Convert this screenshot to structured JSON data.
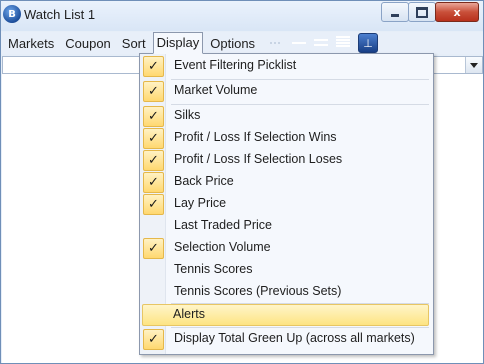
{
  "window": {
    "title": "Watch List 1",
    "app_icon": "B",
    "close_glyph": "x"
  },
  "menubar": {
    "items": [
      "Markets",
      "Coupon",
      "Sort",
      "Display",
      "Options"
    ],
    "open_item": "Display",
    "tool_icons": [
      "dotted-line-icon",
      "single-line-icon",
      "double-line-icon",
      "multi-line-icon",
      "pin-icon"
    ]
  },
  "display_menu": {
    "items": [
      {
        "label": "Event Filtering Picklist",
        "checked": true
      },
      {
        "label": "Market Volume",
        "checked": true
      },
      {
        "label": "Silks",
        "checked": true
      },
      {
        "label": "Profit / Loss If Selection Wins",
        "checked": true
      },
      {
        "label": "Profit / Loss If Selection Loses",
        "checked": true
      },
      {
        "label": "Back Price",
        "checked": true
      },
      {
        "label": "Lay Price",
        "checked": true
      },
      {
        "label": "Last Traded Price",
        "checked": false
      },
      {
        "label": "Selection Volume",
        "checked": true
      },
      {
        "label": "Tennis Scores",
        "checked": false
      },
      {
        "label": "Tennis Scores (Previous Sets)",
        "checked": false
      },
      {
        "label": "Alerts",
        "checked": false,
        "highlighted": true
      },
      {
        "label": "Display Total Green Up (across all markets)",
        "checked": true
      }
    ],
    "check_glyph": "✓",
    "highlight_color": "#fde483",
    "check_color": "#ffd870"
  }
}
